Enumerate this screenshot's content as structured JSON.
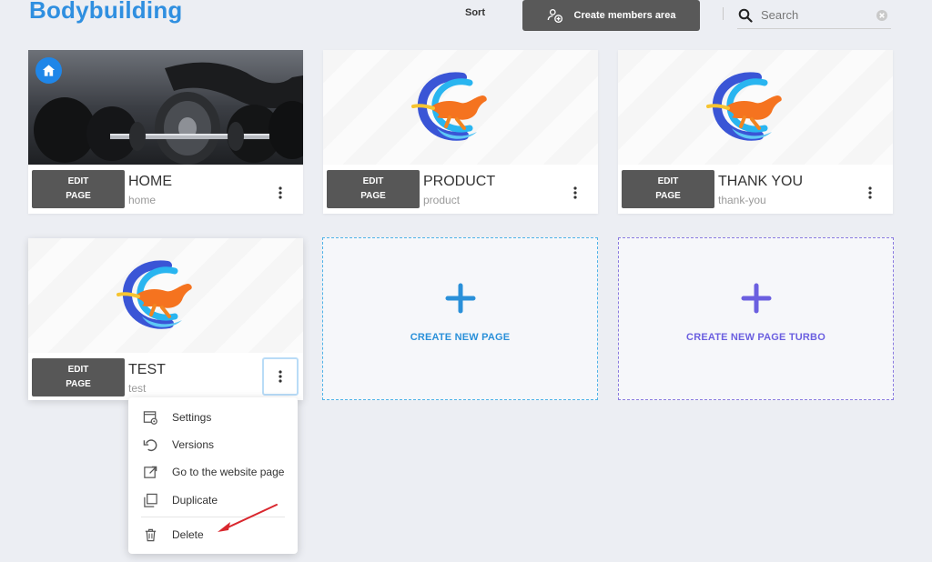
{
  "header": {
    "title": "Bodybuilding",
    "sort_label": "Sort",
    "create_members_label": "Create members area",
    "search": {
      "placeholder": "Search",
      "value": ""
    }
  },
  "cards": [
    {
      "id": "home",
      "edit_line1": "EDIT",
      "edit_line2": "PAGE",
      "name": "HOME",
      "slug": "home",
      "is_home": true
    },
    {
      "id": "product",
      "edit_line1": "EDIT",
      "edit_line2": "PAGE",
      "name": "PRODUCT",
      "slug": "product"
    },
    {
      "id": "thankyou",
      "edit_line1": "EDIT",
      "edit_line2": "PAGE",
      "name": "THANK YOU",
      "slug": "thank-you"
    },
    {
      "id": "test",
      "edit_line1": "EDIT",
      "edit_line2": "PAGE",
      "name": "TEST",
      "slug": "test"
    }
  ],
  "create_tiles": {
    "new_page": "CREATE NEW PAGE",
    "new_page_turbo": "CREATE NEW PAGE TURBO"
  },
  "menu": {
    "items": [
      {
        "label": "Settings",
        "icon": "settings-icon"
      },
      {
        "label": "Versions",
        "icon": "undo-icon"
      },
      {
        "label": "Go to the website page",
        "icon": "external-link-icon"
      },
      {
        "label": "Duplicate",
        "icon": "duplicate-icon"
      },
      {
        "label": "Delete",
        "icon": "trash-icon"
      }
    ]
  },
  "colors": {
    "brand_blue": "#2f8fe0",
    "dark_button": "#575757",
    "turbo_purple": "#6b5fe0",
    "annotation_red": "#d9272e"
  }
}
